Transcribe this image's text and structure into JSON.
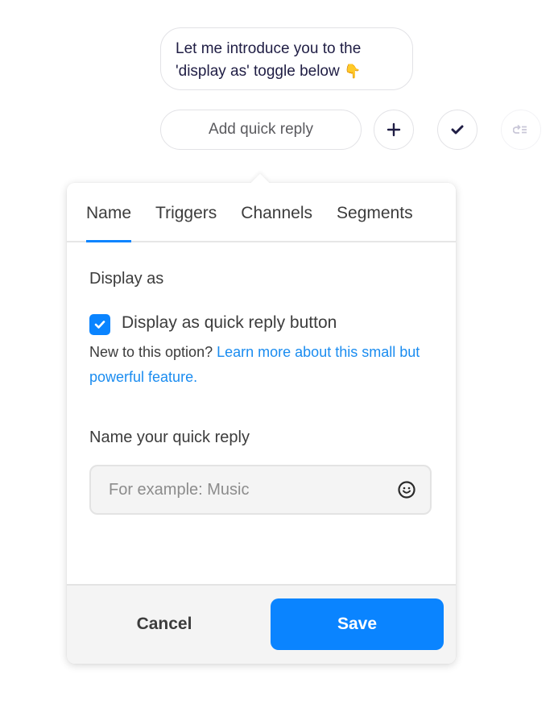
{
  "chat": {
    "message_line1": "Let me introduce you to the",
    "message_line2": "'display as' toggle below",
    "message_emoji": "👇"
  },
  "quick_reply_bar": {
    "add_quick_reply_label": "Add quick reply",
    "buttons": [
      {
        "icon": "plus-icon"
      },
      {
        "icon": "checkmark-icon"
      },
      {
        "icon": "redo-list-icon",
        "state": "disabled"
      }
    ]
  },
  "popup": {
    "tabs": [
      {
        "label": "Name",
        "active": true
      },
      {
        "label": "Triggers",
        "active": false
      },
      {
        "label": "Channels",
        "active": false
      },
      {
        "label": "Segments",
        "active": false
      }
    ],
    "display_as": {
      "section_label": "Display as",
      "checkbox_label": "Display as quick reply button",
      "checked": true,
      "help_text": "New to this option?",
      "help_link": "Learn more about this small but powerful feature."
    },
    "name_field": {
      "label": "Name your quick reply",
      "value": "",
      "placeholder": "For example: Music",
      "emoji_icon": "smiley-icon"
    },
    "footer": {
      "cancel_label": "Cancel",
      "save_label": "Save"
    }
  },
  "colors": {
    "accent": "#0a84ff",
    "link": "#1a8cf0",
    "text_dark": "#1f1d44",
    "text": "#3c3c3c"
  }
}
